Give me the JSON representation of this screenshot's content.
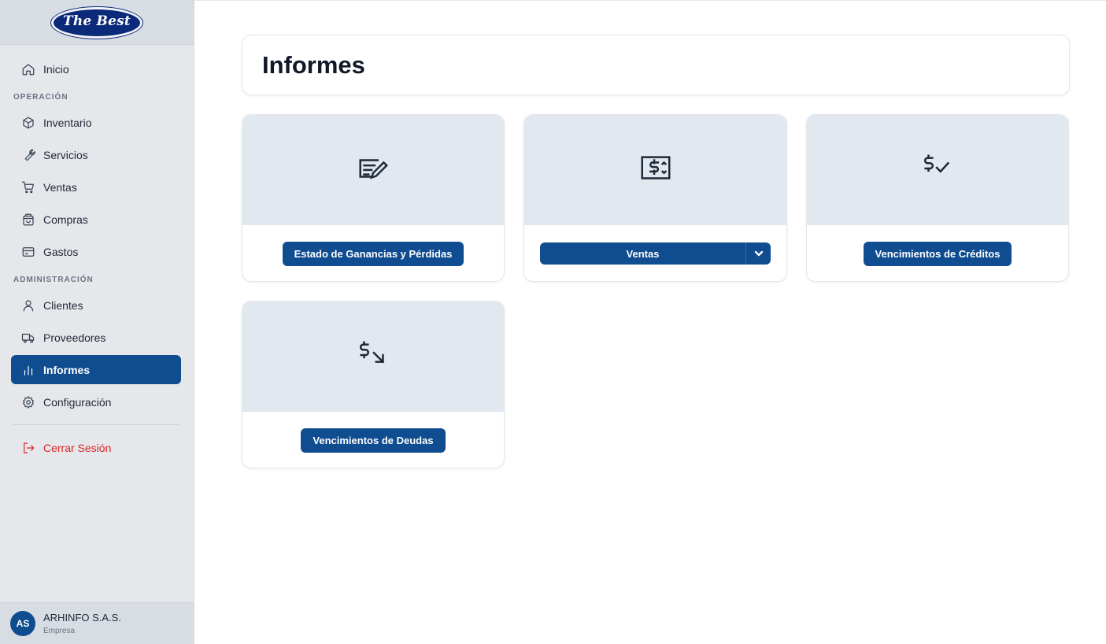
{
  "logo": {
    "text": "The Best"
  },
  "nav": {
    "inicio": "Inicio",
    "section_operacion": "OPERACIÓN",
    "inventario": "Inventario",
    "servicios": "Servicios",
    "ventas": "Ventas",
    "compras": "Compras",
    "gastos": "Gastos",
    "section_administracion": "ADMINISTRACIÓN",
    "clientes": "Clientes",
    "proveedores": "Proveedores",
    "informes": "Informes",
    "configuracion": "Configuración",
    "cerrar_sesion": "Cerrar Sesión",
    "active_item": "informes"
  },
  "user": {
    "initials": "AS",
    "name": "ARHINFO S.A.S.",
    "role": "Empresa"
  },
  "page": {
    "title": "Informes"
  },
  "reports": [
    {
      "label": "Estado de Ganancias y Pérdidas",
      "icon": "document-edit-icon"
    },
    {
      "label": "Ventas",
      "icon": "money-bill-icon",
      "has_dropdown": true
    },
    {
      "label": "Vencimientos de Créditos",
      "icon": "dollar-check-icon"
    },
    {
      "label": "Vencimientos de Deudas",
      "icon": "dollar-down-icon"
    }
  ],
  "colors": {
    "primary": "#0f4c90",
    "sidebar_bg": "#e5e7eb",
    "card_header_bg": "#e2e8f0",
    "logout": "#dc2626"
  }
}
